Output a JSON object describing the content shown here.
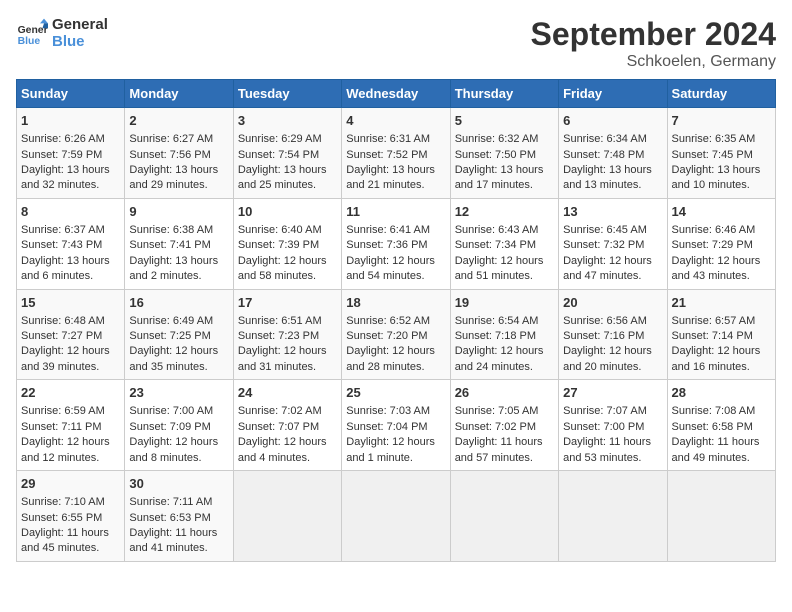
{
  "logo": {
    "line1": "General",
    "line2": "Blue"
  },
  "title": "September 2024",
  "subtitle": "Schkoelen, Germany",
  "days_of_week": [
    "Sunday",
    "Monday",
    "Tuesday",
    "Wednesday",
    "Thursday",
    "Friday",
    "Saturday"
  ],
  "weeks": [
    [
      {
        "day": 1,
        "lines": [
          "Sunrise: 6:26 AM",
          "Sunset: 7:59 PM",
          "Daylight: 13 hours",
          "and 32 minutes."
        ]
      },
      {
        "day": 2,
        "lines": [
          "Sunrise: 6:27 AM",
          "Sunset: 7:56 PM",
          "Daylight: 13 hours",
          "and 29 minutes."
        ]
      },
      {
        "day": 3,
        "lines": [
          "Sunrise: 6:29 AM",
          "Sunset: 7:54 PM",
          "Daylight: 13 hours",
          "and 25 minutes."
        ]
      },
      {
        "day": 4,
        "lines": [
          "Sunrise: 6:31 AM",
          "Sunset: 7:52 PM",
          "Daylight: 13 hours",
          "and 21 minutes."
        ]
      },
      {
        "day": 5,
        "lines": [
          "Sunrise: 6:32 AM",
          "Sunset: 7:50 PM",
          "Daylight: 13 hours",
          "and 17 minutes."
        ]
      },
      {
        "day": 6,
        "lines": [
          "Sunrise: 6:34 AM",
          "Sunset: 7:48 PM",
          "Daylight: 13 hours",
          "and 13 minutes."
        ]
      },
      {
        "day": 7,
        "lines": [
          "Sunrise: 6:35 AM",
          "Sunset: 7:45 PM",
          "Daylight: 13 hours",
          "and 10 minutes."
        ]
      }
    ],
    [
      {
        "day": 8,
        "lines": [
          "Sunrise: 6:37 AM",
          "Sunset: 7:43 PM",
          "Daylight: 13 hours",
          "and 6 minutes."
        ]
      },
      {
        "day": 9,
        "lines": [
          "Sunrise: 6:38 AM",
          "Sunset: 7:41 PM",
          "Daylight: 13 hours",
          "and 2 minutes."
        ]
      },
      {
        "day": 10,
        "lines": [
          "Sunrise: 6:40 AM",
          "Sunset: 7:39 PM",
          "Daylight: 12 hours",
          "and 58 minutes."
        ]
      },
      {
        "day": 11,
        "lines": [
          "Sunrise: 6:41 AM",
          "Sunset: 7:36 PM",
          "Daylight: 12 hours",
          "and 54 minutes."
        ]
      },
      {
        "day": 12,
        "lines": [
          "Sunrise: 6:43 AM",
          "Sunset: 7:34 PM",
          "Daylight: 12 hours",
          "and 51 minutes."
        ]
      },
      {
        "day": 13,
        "lines": [
          "Sunrise: 6:45 AM",
          "Sunset: 7:32 PM",
          "Daylight: 12 hours",
          "and 47 minutes."
        ]
      },
      {
        "day": 14,
        "lines": [
          "Sunrise: 6:46 AM",
          "Sunset: 7:29 PM",
          "Daylight: 12 hours",
          "and 43 minutes."
        ]
      }
    ],
    [
      {
        "day": 15,
        "lines": [
          "Sunrise: 6:48 AM",
          "Sunset: 7:27 PM",
          "Daylight: 12 hours",
          "and 39 minutes."
        ]
      },
      {
        "day": 16,
        "lines": [
          "Sunrise: 6:49 AM",
          "Sunset: 7:25 PM",
          "Daylight: 12 hours",
          "and 35 minutes."
        ]
      },
      {
        "day": 17,
        "lines": [
          "Sunrise: 6:51 AM",
          "Sunset: 7:23 PM",
          "Daylight: 12 hours",
          "and 31 minutes."
        ]
      },
      {
        "day": 18,
        "lines": [
          "Sunrise: 6:52 AM",
          "Sunset: 7:20 PM",
          "Daylight: 12 hours",
          "and 28 minutes."
        ]
      },
      {
        "day": 19,
        "lines": [
          "Sunrise: 6:54 AM",
          "Sunset: 7:18 PM",
          "Daylight: 12 hours",
          "and 24 minutes."
        ]
      },
      {
        "day": 20,
        "lines": [
          "Sunrise: 6:56 AM",
          "Sunset: 7:16 PM",
          "Daylight: 12 hours",
          "and 20 minutes."
        ]
      },
      {
        "day": 21,
        "lines": [
          "Sunrise: 6:57 AM",
          "Sunset: 7:14 PM",
          "Daylight: 12 hours",
          "and 16 minutes."
        ]
      }
    ],
    [
      {
        "day": 22,
        "lines": [
          "Sunrise: 6:59 AM",
          "Sunset: 7:11 PM",
          "Daylight: 12 hours",
          "and 12 minutes."
        ]
      },
      {
        "day": 23,
        "lines": [
          "Sunrise: 7:00 AM",
          "Sunset: 7:09 PM",
          "Daylight: 12 hours",
          "and 8 minutes."
        ]
      },
      {
        "day": 24,
        "lines": [
          "Sunrise: 7:02 AM",
          "Sunset: 7:07 PM",
          "Daylight: 12 hours",
          "and 4 minutes."
        ]
      },
      {
        "day": 25,
        "lines": [
          "Sunrise: 7:03 AM",
          "Sunset: 7:04 PM",
          "Daylight: 12 hours",
          "and 1 minute."
        ]
      },
      {
        "day": 26,
        "lines": [
          "Sunrise: 7:05 AM",
          "Sunset: 7:02 PM",
          "Daylight: 11 hours",
          "and 57 minutes."
        ]
      },
      {
        "day": 27,
        "lines": [
          "Sunrise: 7:07 AM",
          "Sunset: 7:00 PM",
          "Daylight: 11 hours",
          "and 53 minutes."
        ]
      },
      {
        "day": 28,
        "lines": [
          "Sunrise: 7:08 AM",
          "Sunset: 6:58 PM",
          "Daylight: 11 hours",
          "and 49 minutes."
        ]
      }
    ],
    [
      {
        "day": 29,
        "lines": [
          "Sunrise: 7:10 AM",
          "Sunset: 6:55 PM",
          "Daylight: 11 hours",
          "and 45 minutes."
        ]
      },
      {
        "day": 30,
        "lines": [
          "Sunrise: 7:11 AM",
          "Sunset: 6:53 PM",
          "Daylight: 11 hours",
          "and 41 minutes."
        ]
      },
      null,
      null,
      null,
      null,
      null
    ]
  ]
}
